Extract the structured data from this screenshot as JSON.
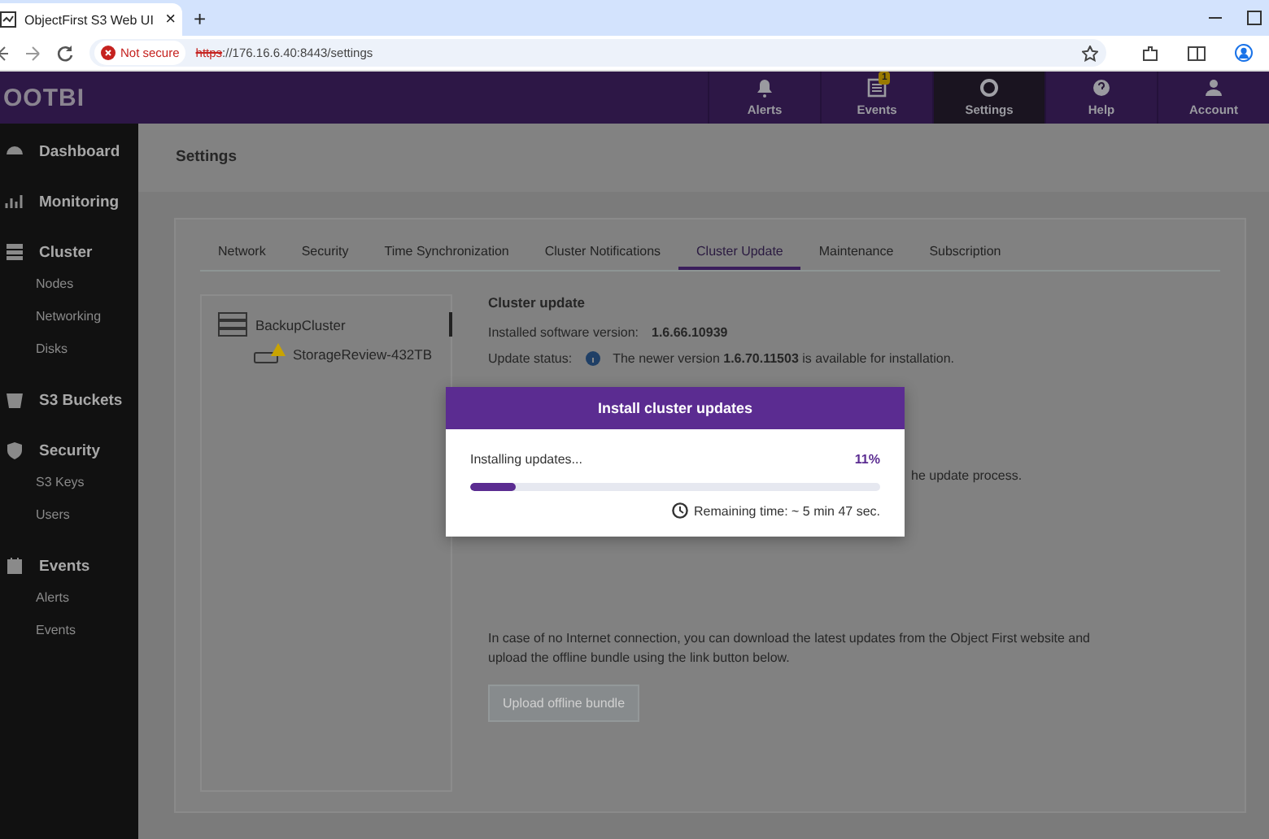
{
  "browser": {
    "tab_title": "ObjectFirst S3 Web UI",
    "close": "×",
    "new_tab": "+",
    "security_chip": "Not secure",
    "url_scheme": "https",
    "url_rest": "://176.16.6.40:8443/settings"
  },
  "app": {
    "logo": "OOTBI",
    "nav": [
      {
        "kind": "bell",
        "label": "Alerts",
        "selected": false
      },
      {
        "kind": "list",
        "label": "Events",
        "selected": false,
        "badge": "1"
      },
      {
        "kind": "gear",
        "label": "Settings",
        "selected": true
      },
      {
        "kind": "help",
        "label": "Help",
        "selected": false
      },
      {
        "kind": "user",
        "label": "Account",
        "selected": false
      }
    ]
  },
  "sidebar": [
    {
      "kind": "gauge",
      "label": "Dashboard"
    },
    {
      "kind": "chart",
      "label": "Monitoring"
    },
    {
      "kind": "stack",
      "label": "Cluster",
      "children": [
        "Nodes",
        "Networking",
        "Disks"
      ]
    },
    {
      "kind": "bucket",
      "label": "S3 Buckets"
    },
    {
      "kind": "shield",
      "label": "Security",
      "children": [
        "S3 Keys",
        "Users"
      ]
    },
    {
      "kind": "calendar",
      "label": "Events",
      "children": [
        "Alerts",
        "Events"
      ]
    }
  ],
  "page_title": "Settings",
  "tabs": [
    {
      "label": "Network",
      "selected": false
    },
    {
      "label": "Security",
      "selected": false
    },
    {
      "label": "Time Synchronization",
      "selected": false
    },
    {
      "label": "Cluster Notifications",
      "selected": false
    },
    {
      "label": "Cluster Update",
      "selected": true
    },
    {
      "label": "Maintenance",
      "selected": false
    },
    {
      "label": "Subscription",
      "selected": false
    }
  ],
  "tree": {
    "label": "BackupCluster",
    "selected": true,
    "children": [
      {
        "label": "StorageReview-432TB",
        "warning": true
      }
    ]
  },
  "cluster_update": {
    "title": "Cluster update",
    "installed_label": "Installed software version:",
    "installed_value": "1.6.66.10939",
    "status_label": "Update status:",
    "status_text": "The newer version **1.6.70.11503** is available for installation.",
    "partial_text": "he update process.",
    "offline_text": "In case of no Internet connection, you can download the latest updates from the Object First website and upload the offline bundle using the link button below.",
    "offline_button": {
      "label": "Upload offline bundle",
      "disabled": true
    }
  },
  "modal": {
    "title": "Install cluster updates",
    "status": "Installing updates...",
    "percent": "11%",
    "level": 0.11,
    "remaining": "Remaining time: ~ 5 min 47 sec."
  }
}
